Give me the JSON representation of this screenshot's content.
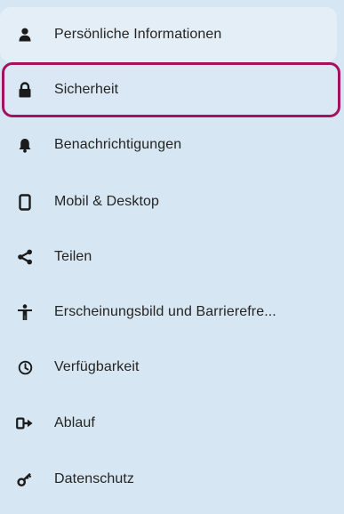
{
  "sidebar": {
    "items": [
      {
        "label": "Persönliche Informationen",
        "icon": "person-icon"
      },
      {
        "label": "Sicherheit",
        "icon": "lock-icon",
        "selected": true
      },
      {
        "label": "Benachrichtigungen",
        "icon": "bell-icon"
      },
      {
        "label": "Mobil & Desktop",
        "icon": "mobile-device-icon"
      },
      {
        "label": "Teilen",
        "icon": "share-icon"
      },
      {
        "label": "Erscheinungsbild und Barrierefre...",
        "icon": "accessibility-icon"
      },
      {
        "label": "Verfügbarkeit",
        "icon": "clock-icon"
      },
      {
        "label": "Ablauf",
        "icon": "sign-out-icon"
      },
      {
        "label": "Datenschutz",
        "icon": "key-icon"
      }
    ]
  },
  "colors": {
    "panel_background": "#d6e7f3",
    "selection_border": "#a5115f",
    "text": "#252423"
  }
}
